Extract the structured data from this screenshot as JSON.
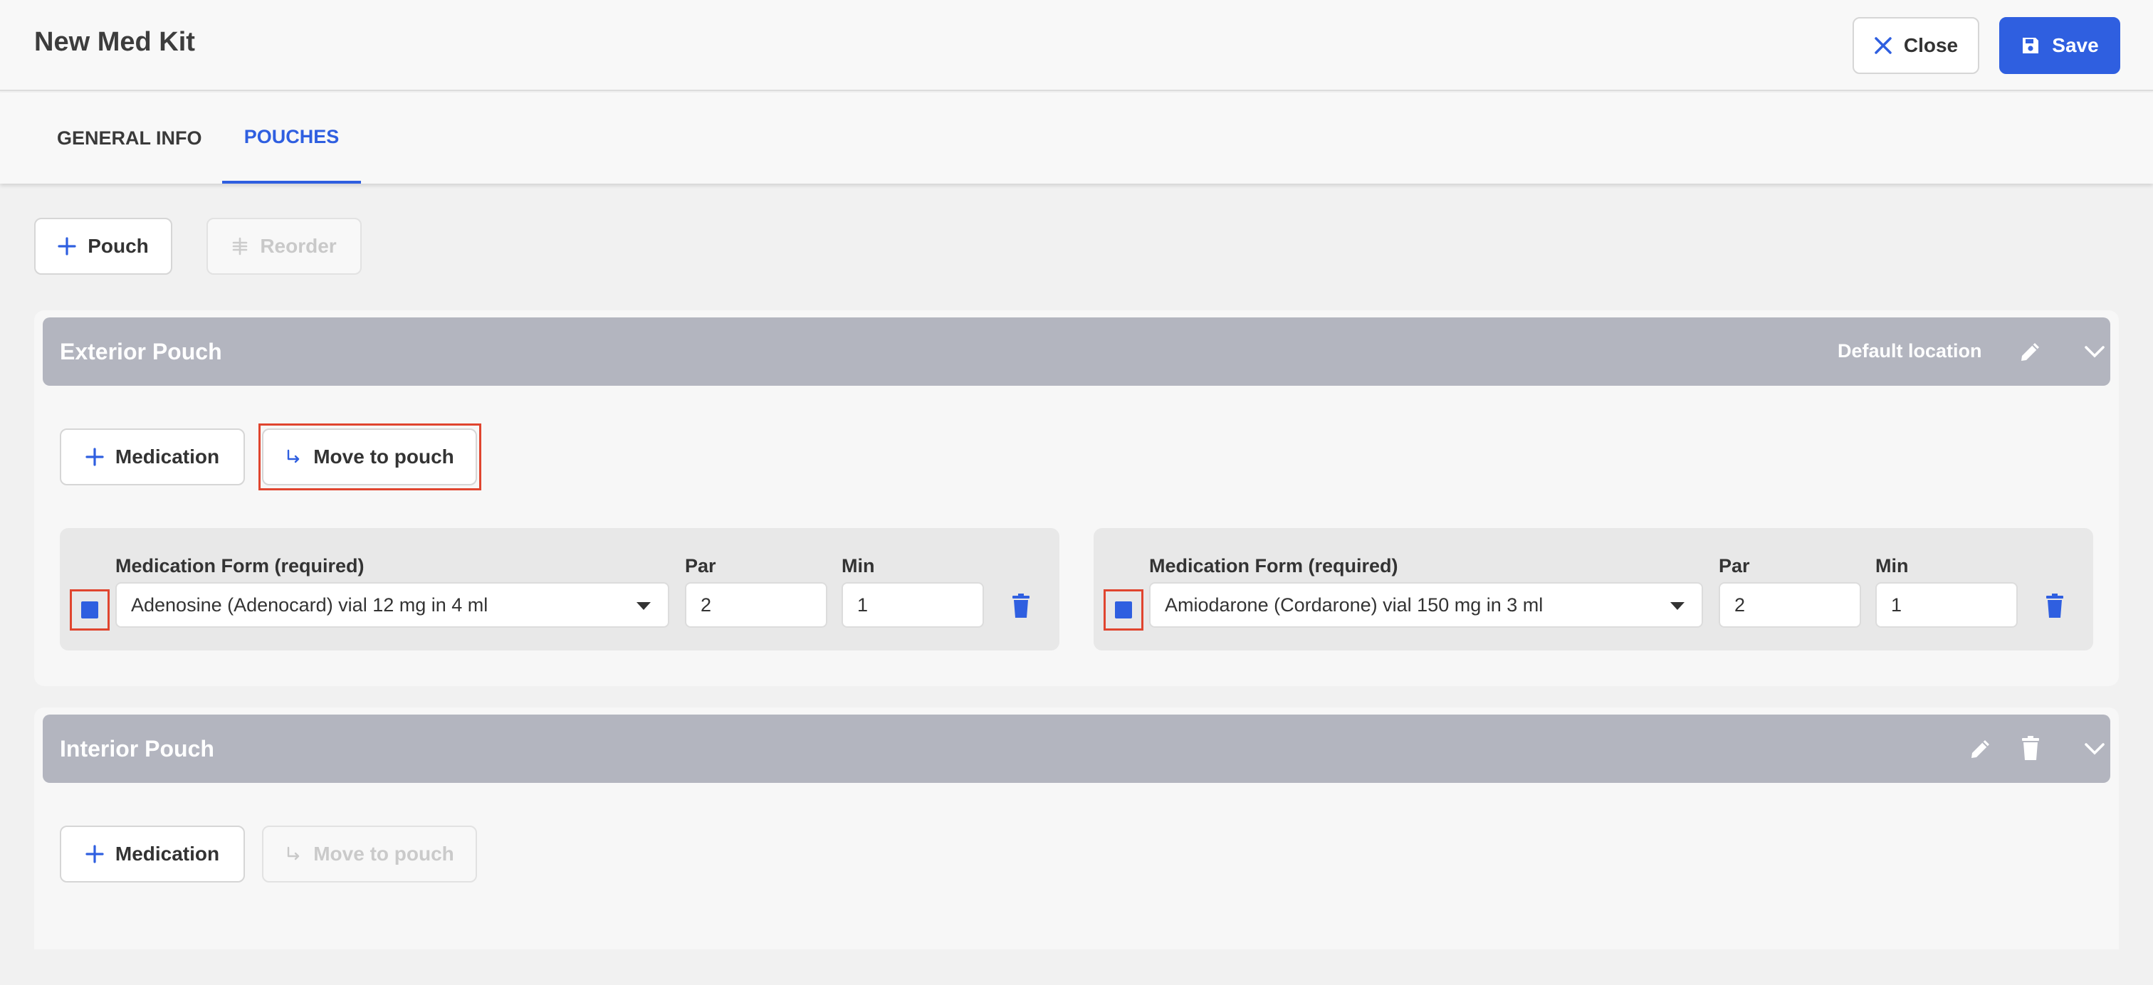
{
  "header": {
    "title": "New Med Kit",
    "close_label": "Close",
    "save_label": "Save"
  },
  "tabs": [
    {
      "label": "GENERAL INFO",
      "active": false
    },
    {
      "label": "POUCHES",
      "active": true
    }
  ],
  "toolbar": {
    "add_pouch_label": "Pouch",
    "reorder_label": "Reorder"
  },
  "pouches": [
    {
      "title": "Exterior Pouch",
      "location": "Default location",
      "add_medication_label": "Medication",
      "move_label": "Move to pouch",
      "medications": [
        {
          "form_label": "Medication Form (required)",
          "form_value": "Adenosine (Adenocard) vial 12 mg in 4 ml",
          "par_label": "Par",
          "par_value": "2",
          "min_label": "Min",
          "min_value": "1",
          "checked": true
        },
        {
          "form_label": "Medication Form (required)",
          "form_value": "Amiodarone (Cordarone) vial 150 mg in 3 ml",
          "par_label": "Par",
          "par_value": "2",
          "min_label": "Min",
          "min_value": "1",
          "checked": true
        }
      ]
    },
    {
      "title": "Interior Pouch",
      "add_medication_label": "Medication",
      "move_label": "Move to pouch",
      "medications": []
    }
  ],
  "colors": {
    "accent": "#2f5fe0",
    "highlight": "#e0452f",
    "pouch_header": "#b3b5bf"
  }
}
